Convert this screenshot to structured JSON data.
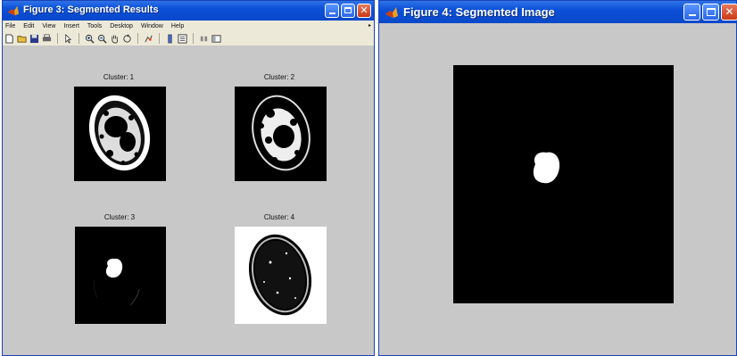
{
  "window1": {
    "title": "Figure 3: Segmented Results",
    "menu": [
      "File",
      "Edit",
      "View",
      "Insert",
      "Tools",
      "Desktop",
      "Window",
      "Help"
    ],
    "menu_overflow_arrow": "▸",
    "subplots": [
      {
        "title": "Cluster: 1"
      },
      {
        "title": "Cluster: 2"
      },
      {
        "title": "Cluster: 3"
      },
      {
        "title": "Cluster: 4"
      }
    ]
  },
  "window2": {
    "title": "Figure 4: Segmented Image"
  },
  "icons": {
    "app": "matlab-icon",
    "minimize": "minimize-icon",
    "maximize": "maximize-icon",
    "close": "close-icon"
  },
  "colors": {
    "titlebar": "#0b50d8",
    "figure_bg": "#c8c8c8",
    "menubar_bg": "#ece9d8",
    "close_button": "#c83a18"
  }
}
